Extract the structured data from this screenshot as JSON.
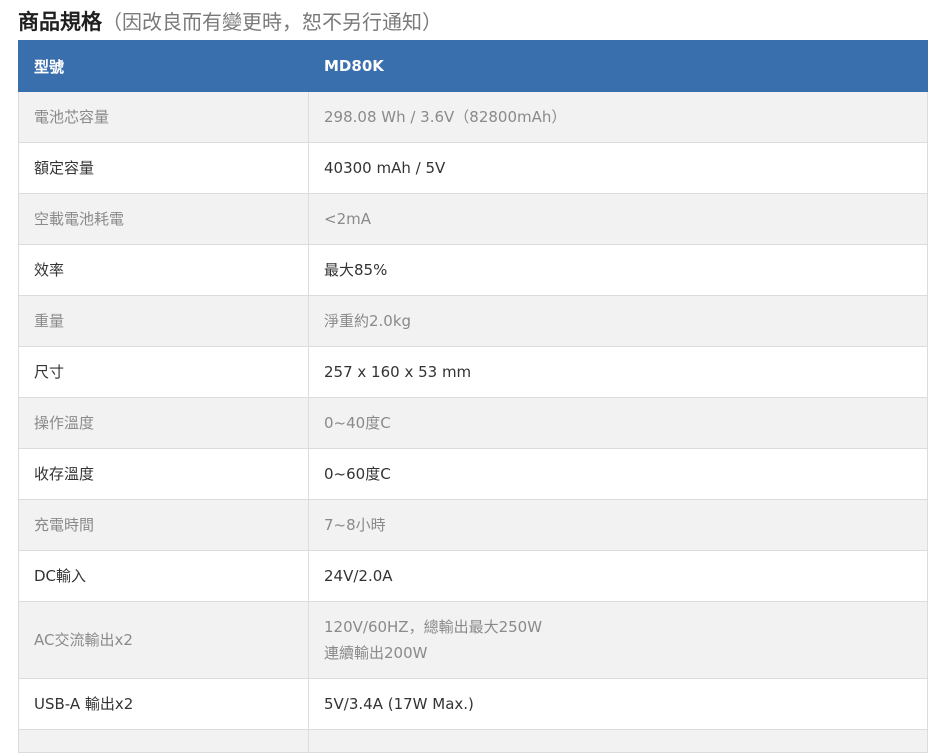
{
  "title": {
    "main": "商品規格",
    "note": "（因改良而有變更時，恕不另行通知）"
  },
  "table": {
    "headers": [
      "型號",
      "MD80K"
    ],
    "rows": [
      {
        "label": "電池芯容量",
        "value": [
          "298.08 Wh / 3.6V（82800mAh）"
        ]
      },
      {
        "label": "額定容量",
        "value": [
          "40300 mAh / 5V"
        ]
      },
      {
        "label": "空載電池耗電",
        "value": [
          "<2mA"
        ]
      },
      {
        "label": "效率",
        "value": [
          "最大85%"
        ]
      },
      {
        "label": "重量",
        "value": [
          "淨重約2.0kg"
        ]
      },
      {
        "label": "尺寸",
        "value": [
          "257 x 160 x 53 mm"
        ]
      },
      {
        "label": "操作溫度",
        "value": [
          "0~40度C"
        ]
      },
      {
        "label": "收存溫度",
        "value": [
          "0~60度C"
        ]
      },
      {
        "label": "充電時間",
        "value": [
          "7~8小時"
        ]
      },
      {
        "label": "DC輸入",
        "value": [
          "24V/2.0A"
        ]
      },
      {
        "label": "AC交流輸出x2",
        "value": [
          "120V/60HZ，總輸出最大250W",
          "連續輸出200W"
        ]
      },
      {
        "label": "USB-A 輸出x2",
        "value": [
          "5V/3.4A (17W Max.)"
        ]
      }
    ]
  },
  "colors": {
    "header_bg": "#3a6fae",
    "header_text": "#ffffff",
    "stripe_bg": "#f2f2f2",
    "border": "#dcdcdc"
  }
}
